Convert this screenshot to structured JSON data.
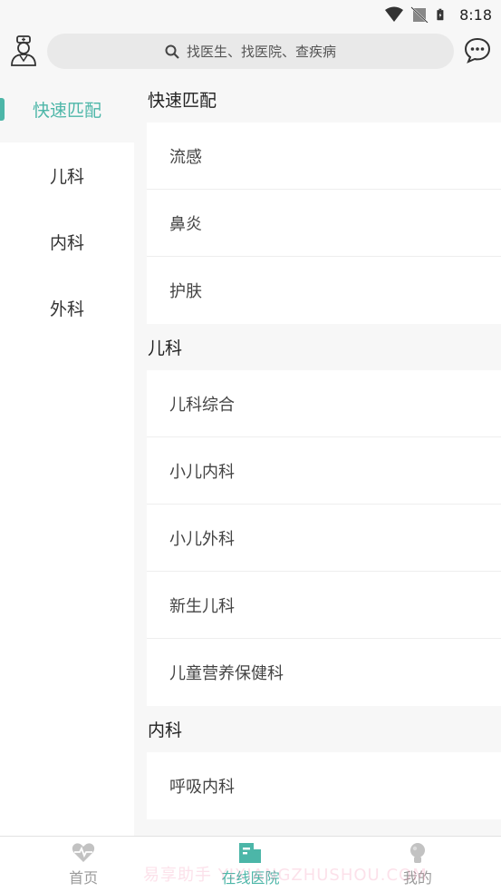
{
  "status_bar": {
    "time": "8:18"
  },
  "search": {
    "placeholder": "找医生、找医院、查疾病"
  },
  "sidebar": {
    "items": [
      {
        "label": "快速匹配",
        "active": true
      },
      {
        "label": "儿科",
        "active": false
      },
      {
        "label": "内科",
        "active": false
      },
      {
        "label": "外科",
        "active": false
      }
    ]
  },
  "sections": [
    {
      "title": "快速匹配",
      "items": [
        "流感",
        "鼻炎",
        "护肤"
      ]
    },
    {
      "title": "儿科",
      "items": [
        "儿科综合",
        "小儿内科",
        "小儿外科",
        "新生儿科",
        "儿童营养保健科"
      ]
    },
    {
      "title": "内科",
      "items": [
        "呼吸内科"
      ]
    }
  ],
  "tabs": [
    {
      "label": "首页",
      "icon": "heart-pulse-icon",
      "active": false
    },
    {
      "label": "在线医院",
      "icon": "hospital-card-icon",
      "active": true
    },
    {
      "label": "我的",
      "icon": "profile-icon",
      "active": false
    }
  ],
  "watermark": "易享助手 YIXIANGZHUSHOU.COM",
  "colors": {
    "accent": "#4cb6a8",
    "background": "#f7f7f7"
  }
}
